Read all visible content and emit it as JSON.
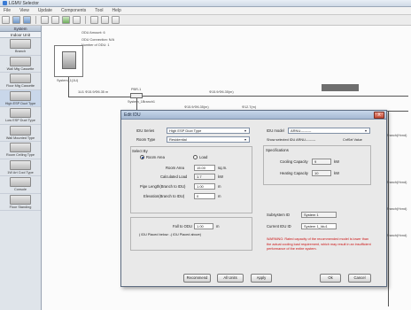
{
  "window": {
    "title": "LGMV Selector"
  },
  "menu": [
    "File",
    "View",
    "Update",
    "Components",
    "Tool",
    "Help"
  ],
  "sidebar": {
    "header": "System",
    "subheader": "Indoor Unit",
    "items": [
      {
        "label": "Branch"
      },
      {
        "label": "Wall Mtg Cassette"
      },
      {
        "label": "Floor Mtg Cassette"
      },
      {
        "label": "High ESP Duct Type"
      },
      {
        "label": "Low ESP Duct Type"
      },
      {
        "label": "Wall Mounted Type"
      },
      {
        "label": "Room Ceiling Type"
      },
      {
        "label": "1W Art Cool Type"
      },
      {
        "label": "Console"
      },
      {
        "label": "Floor Standing"
      }
    ]
  },
  "canvas": {
    "odu_label": "ODU Amount: 6",
    "odu_notes": [
      "ODU Connection: N/A",
      "Number of ODU: 1"
    ],
    "system_label": "System_1(1U)",
    "pipe_label": "1U1 Φ15.9/Φ6.35 m",
    "node_labels": [
      "PBR-1",
      "System_1Branch1"
    ],
    "right_labels": [
      "Φ15.9/Φ6.35(m)",
      "Φ15.9/Φ6.35(m)",
      "Φ12.7(m)"
    ],
    "side_labels": [
      "Branch(Hvnd)",
      "Branch(Hvnd)",
      "Branch(Hvnd)",
      "Branch(Hvnd)"
    ]
  },
  "dialog": {
    "title": "Edit IDU",
    "close": "X",
    "idu_series_label": "IDU Series",
    "idu_series_value": "High ESP Duct Type",
    "room_type_label": "Room Type",
    "room_type_value": "Residential",
    "idu_model_label": "IDU model",
    "idu_model_value": "ARNU---------",
    "select_by_label": "Select By",
    "radio_room_area": "Room Area",
    "radio_load": "Load",
    "room_area_label": "Room Area",
    "room_area_value": "15.00",
    "room_area_unit": "sq.m.",
    "calc_load_label": "Calculated Load",
    "calc_load_value": "1.7",
    "calc_load_unit": "kW",
    "pipe_length_label": "Pipe Length(Branch to IDU)",
    "pipe_length_value": "1.00",
    "pipe_length_unit": "m",
    "elevation_label": "Elevation(Branch to IDU)",
    "elevation_value": "0",
    "elevation_unit": "m",
    "fall_label": "Fall to ODU",
    "fall_value": "1.00",
    "fall_unit": "m",
    "fall_note": "( IDU Placed below: -) IDU Placed above)",
    "show_selected_label": "Show selected IDU ARNU---------",
    "set_value_label": "CnfSel Value",
    "specs_label": "Specifications",
    "cooling_label": "Cooling Capacity",
    "cooling_value": "9",
    "cooling_unit": "kW",
    "heating_label": "Heating Capacity",
    "heating_value": "10",
    "heating_unit": "kW",
    "subsystem_label": "Subsystem ID",
    "subsystem_value": "System 1",
    "current_idu_label": "Current IDU ID",
    "current_idu_value": "System 1_Idu1",
    "warning": "WARNING: Rated capacity of the recommended model is lower than the actual cooling load requirement, which may result in an insufficient performance of the entire system.",
    "buttons": {
      "recommend": "Recommend",
      "all_units": "All Units",
      "apply": "Apply",
      "ok": "Ok",
      "cancel": "Cancel"
    }
  },
  "colors": {
    "accent": "#3a7bd5",
    "warning": "#cc1111",
    "dialog_title": "#a5b9d3"
  }
}
